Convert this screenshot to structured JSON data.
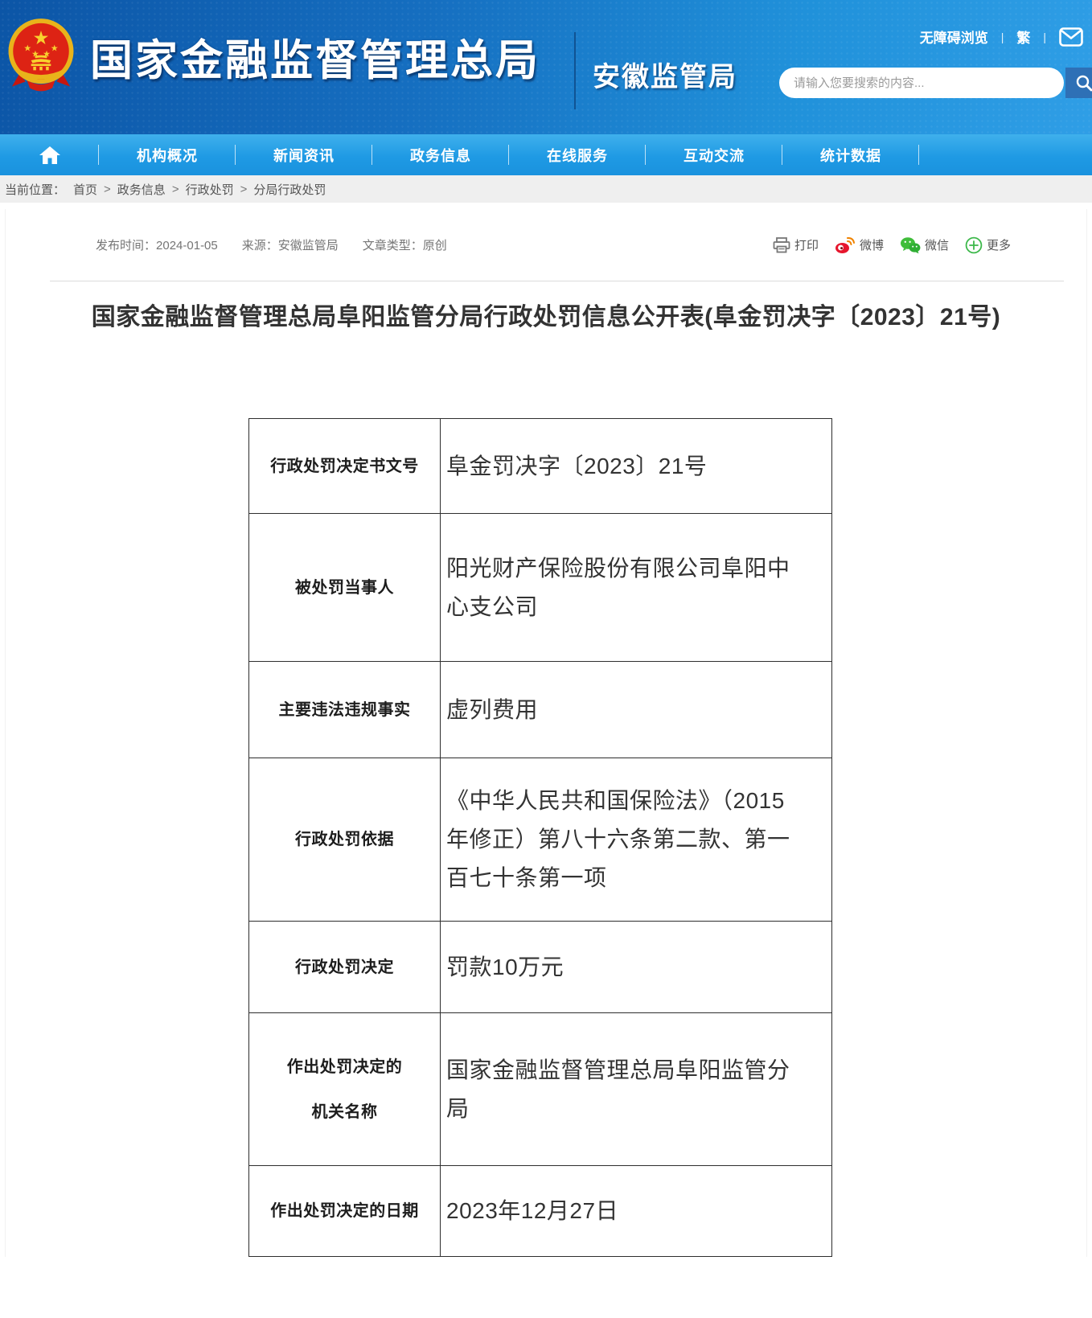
{
  "header": {
    "site_title": "国家金融监督管理总局",
    "bureau_name": "安徽监管局",
    "accessibility_link": "无障碍浏览",
    "traditional_link": "繁",
    "links_separator": "|",
    "search_placeholder": "请输入您要搜索的内容..."
  },
  "nav": {
    "items": [
      "机构概况",
      "新闻资讯",
      "政务信息",
      "在线服务",
      "互动交流",
      "统计数据"
    ]
  },
  "breadcrumb": {
    "label": "当前位置：",
    "separator": ">",
    "items": [
      "首页",
      "政务信息",
      "行政处罚",
      "分局行政处罚"
    ]
  },
  "article": {
    "meta": {
      "publish_label": "发布时间：",
      "publish_date": "2024-01-05",
      "source_label": "来源：",
      "source_value": "安徽监管局",
      "type_label": "文章类型：",
      "type_value": "原创"
    },
    "actions": {
      "print": "打印",
      "weibo": "微博",
      "wechat": "微信",
      "more": "更多"
    },
    "title": "国家金融监督管理总局阜阳监管分局行政处罚信息公开表(阜金罚决字〔2023〕21号)",
    "table": {
      "rows": [
        {
          "label": "行政处罚决定书文号",
          "value": "阜金罚决字〔2023〕21号"
        },
        {
          "label": "被处罚当事人",
          "value": "阳光财产保险股份有限公司阜阳中心支公司"
        },
        {
          "label": "主要违法违规事实",
          "value": "虚列费用"
        },
        {
          "label": "行政处罚依据",
          "value": "《中华人民共和国保险法》（2015年修正）第八十六条第二款、第一百七十条第一项"
        },
        {
          "label": "行政处罚决定",
          "value": "罚款10万元"
        },
        {
          "label_line1": "作出处罚决定的",
          "label_line2": "机关名称",
          "value": "国家金融监督管理总局阜阳监管分局"
        },
        {
          "label": "作出处罚决定的日期",
          "value": "2023年12月27日"
        }
      ]
    }
  },
  "colors": {
    "banner_blue_dark": "#0c55a6",
    "banner_blue_light": "#2f9ee6",
    "nav_blue": "#1f9ae4",
    "search_button_blue": "#2e70b6",
    "weibo_red": "#e6162d",
    "wechat_green": "#45b035",
    "more_green": "#3cb84a",
    "table_border": "#2e2e2e"
  }
}
